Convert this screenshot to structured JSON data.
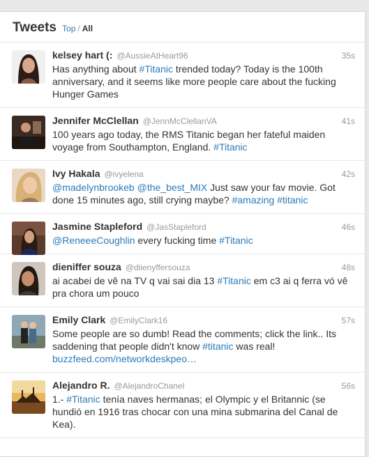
{
  "header": {
    "title": "Tweets",
    "filter_top": "Top",
    "filter_sep": "/",
    "filter_all": "All"
  },
  "colors": {
    "link": "#2b7bb9",
    "text": "#333333",
    "muted": "#999999"
  },
  "tweets": [
    {
      "name": "kelsey hart (:",
      "handle": "@AussieAtHeart96",
      "time": "35s",
      "avatar": "avatar-photo",
      "parts": [
        {
          "t": "Has anything about "
        },
        {
          "t": "#Titanic",
          "link": true
        },
        {
          "t": " trended today? Today is the 100th anniversary, and it seems like more people care about the fucking Hunger Games"
        }
      ]
    },
    {
      "name": "Jennifer McClellan",
      "handle": "@JennMcClellanVA",
      "time": "41s",
      "avatar": "avatar-photo",
      "parts": [
        {
          "t": "100 years ago today, the RMS Titanic began her fateful maiden voyage from Southampton, England. "
        },
        {
          "t": "#Titanic",
          "link": true
        }
      ]
    },
    {
      "name": "Ivy Hakala",
      "handle": "@ivyelena",
      "time": "42s",
      "avatar": "avatar-photo",
      "parts": [
        {
          "t": "@madelynbrookeb",
          "link": true
        },
        {
          "t": " "
        },
        {
          "t": "@the_best_MIX",
          "link": true
        },
        {
          "t": " Just saw your fav movie. Got done 15 minutes ago, still crying maybe? "
        },
        {
          "t": "#amazing",
          "link": true
        },
        {
          "t": " "
        },
        {
          "t": "#titanic",
          "link": true
        }
      ]
    },
    {
      "name": "Jasmine Stapleford",
      "handle": "@JasStapleford",
      "time": "46s",
      "avatar": "avatar-photo",
      "parts": [
        {
          "t": "@ReneeeCoughlin",
          "link": true
        },
        {
          "t": " every fucking time "
        },
        {
          "t": "#Titanic",
          "link": true
        }
      ]
    },
    {
      "name": "dieniffer souza",
      "handle": "@diienyffersouza",
      "time": "48s",
      "avatar": "avatar-photo",
      "parts": [
        {
          "t": "ai acabei de vê na TV q vai sai dia 13 "
        },
        {
          "t": "#Titanic",
          "link": true
        },
        {
          "t": " em c3 ai q ferra vó vê pra chora um pouco"
        }
      ]
    },
    {
      "name": "Emily Clark",
      "handle": "@EmilyClark16",
      "time": "57s",
      "avatar": "avatar-photo",
      "parts": [
        {
          "t": "Some people are so dumb! Read the comments; click the link.. Its saddening that people didn't know "
        },
        {
          "t": "#titanic",
          "link": true
        },
        {
          "t": " was real! "
        },
        {
          "t": "buzzfeed.com/networkdeskpeo…",
          "link": true
        }
      ]
    },
    {
      "name": "Alejandro R.",
      "handle": "@AlejandroChanel",
      "time": "56s",
      "avatar": "avatar-photo",
      "parts": [
        {
          "t": "1.- "
        },
        {
          "t": "#Titanic",
          "link": true
        },
        {
          "t": " tenía naves hermanas; el Olympic y el Britannic (se hundió en 1916 tras chocar con una mina submarina del Canal de Kea)."
        }
      ]
    }
  ]
}
